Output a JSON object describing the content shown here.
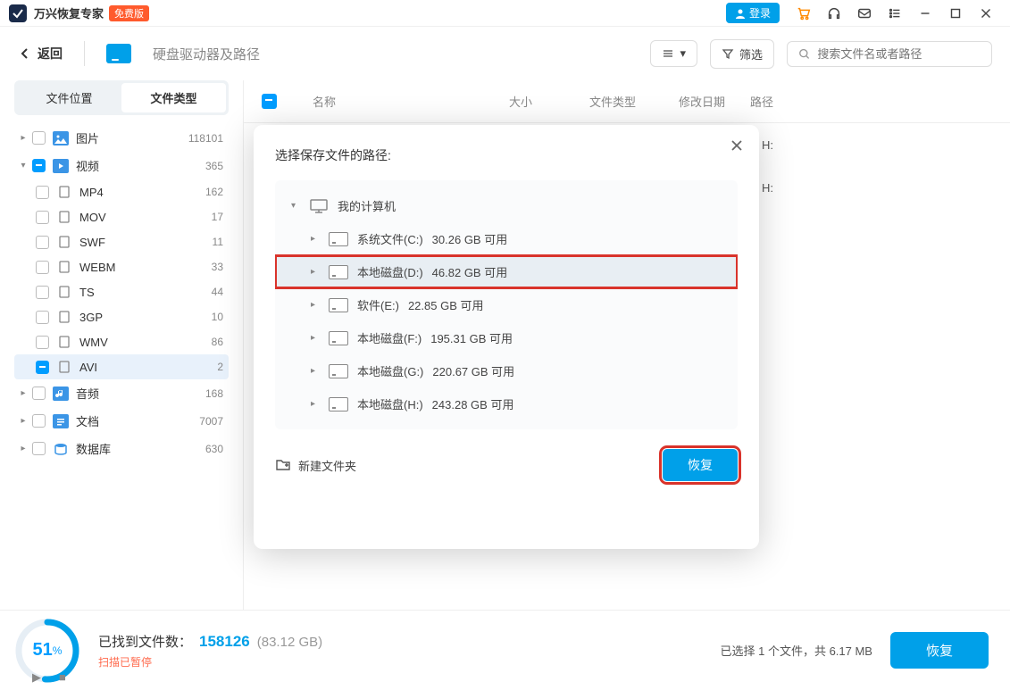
{
  "app": {
    "name": "万兴恢复专家",
    "free_badge": "免费版",
    "login": "登录"
  },
  "toolbar": {
    "back": "返回",
    "page_title": "硬盘驱动器及路径",
    "filter": "筛选",
    "search_placeholder": "搜索文件名或者路径"
  },
  "sidebar": {
    "tabs": {
      "location": "文件位置",
      "type": "文件类型"
    },
    "items": [
      {
        "label": "图片",
        "count": "118101",
        "kind": "image"
      },
      {
        "label": "视频",
        "count": "365",
        "kind": "video",
        "expanded": true,
        "indet": true,
        "children": [
          {
            "label": "MP4",
            "count": "162"
          },
          {
            "label": "MOV",
            "count": "17"
          },
          {
            "label": "SWF",
            "count": "11"
          },
          {
            "label": "WEBM",
            "count": "33"
          },
          {
            "label": "TS",
            "count": "44"
          },
          {
            "label": "3GP",
            "count": "10"
          },
          {
            "label": "WMV",
            "count": "86"
          },
          {
            "label": "AVI",
            "count": "2",
            "indet": true,
            "selected": true
          }
        ]
      },
      {
        "label": "音频",
        "count": "168",
        "kind": "audio"
      },
      {
        "label": "文档",
        "count": "7007",
        "kind": "doc"
      },
      {
        "label": "数据库",
        "count": "630",
        "kind": "db"
      }
    ]
  },
  "list": {
    "headers": {
      "name": "名称",
      "size": "大小",
      "type": "文件类型",
      "date": "修改日期",
      "path": "路径"
    },
    "rows": [
      {
        "path": "H:"
      },
      {
        "path": "H:"
      }
    ]
  },
  "footer": {
    "percent": "51",
    "unit": "%",
    "found_label": "已找到文件数：",
    "found_count": "158126",
    "found_size": "(83.12 GB)",
    "paused": "扫描已暂停",
    "selected_text": "已选择 1 个文件，共 6.17 MB",
    "recover": "恢复"
  },
  "modal": {
    "title": "选择保存文件的路径:",
    "root": "我的计算机",
    "drives": [
      {
        "name": "系统文件(C:)",
        "free": "30.26 GB 可用"
      },
      {
        "name": "本地磁盘(D:)",
        "free": "46.82 GB 可用",
        "selected": true,
        "highlighted": true
      },
      {
        "name": "软件(E:)",
        "free": "22.85 GB 可用"
      },
      {
        "name": "本地磁盘(F:)",
        "free": "195.31 GB 可用"
      },
      {
        "name": "本地磁盘(G:)",
        "free": "220.67 GB 可用"
      },
      {
        "name": "本地磁盘(H:)",
        "free": "243.28 GB 可用"
      }
    ],
    "new_folder": "新建文件夹",
    "recover": "恢复"
  }
}
